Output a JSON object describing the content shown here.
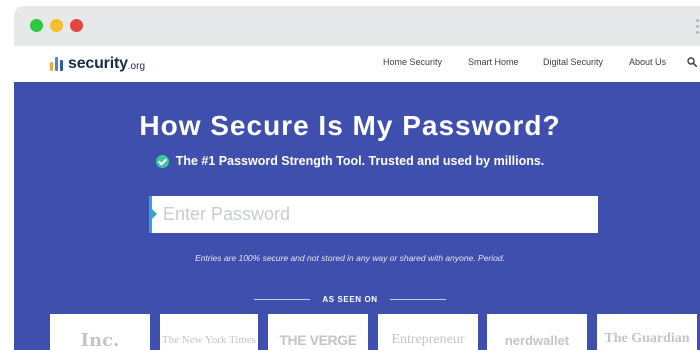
{
  "window": {
    "title_controls": [
      "close",
      "minimize",
      "maximize"
    ]
  },
  "brand": {
    "logo_main": "security",
    "logo_tld": ".org"
  },
  "nav": {
    "items": [
      {
        "label": "Home Security"
      },
      {
        "label": "Smart Home"
      },
      {
        "label": "Digital Security"
      },
      {
        "label": "About Us"
      }
    ],
    "search_icon": "search-icon"
  },
  "hero": {
    "title": "How Secure Is My Password?",
    "subtitle": "The #1 Password Strength Tool. Trusted and used by millions.",
    "password_placeholder": "Enter Password",
    "password_value": "",
    "disclaimer": "Entries are 100% secure and not stored in any way or shared with anyone. Period.",
    "seen_on_label": "AS SEEN ON"
  },
  "press": [
    {
      "name": "Inc."
    },
    {
      "name": "The New York Times"
    },
    {
      "name": "THE VERGE"
    },
    {
      "name": "Entrepreneur"
    },
    {
      "name": "nerdwallet"
    },
    {
      "name": "The Guardian"
    }
  ],
  "colors": {
    "hero_bg": "#3f4fae",
    "accent_blue": "#3b9fd9",
    "check_green": "#3cc59a",
    "dot_green": "#2bc840",
    "dot_yellow": "#f6bd2d",
    "dot_red": "#e3463c"
  }
}
